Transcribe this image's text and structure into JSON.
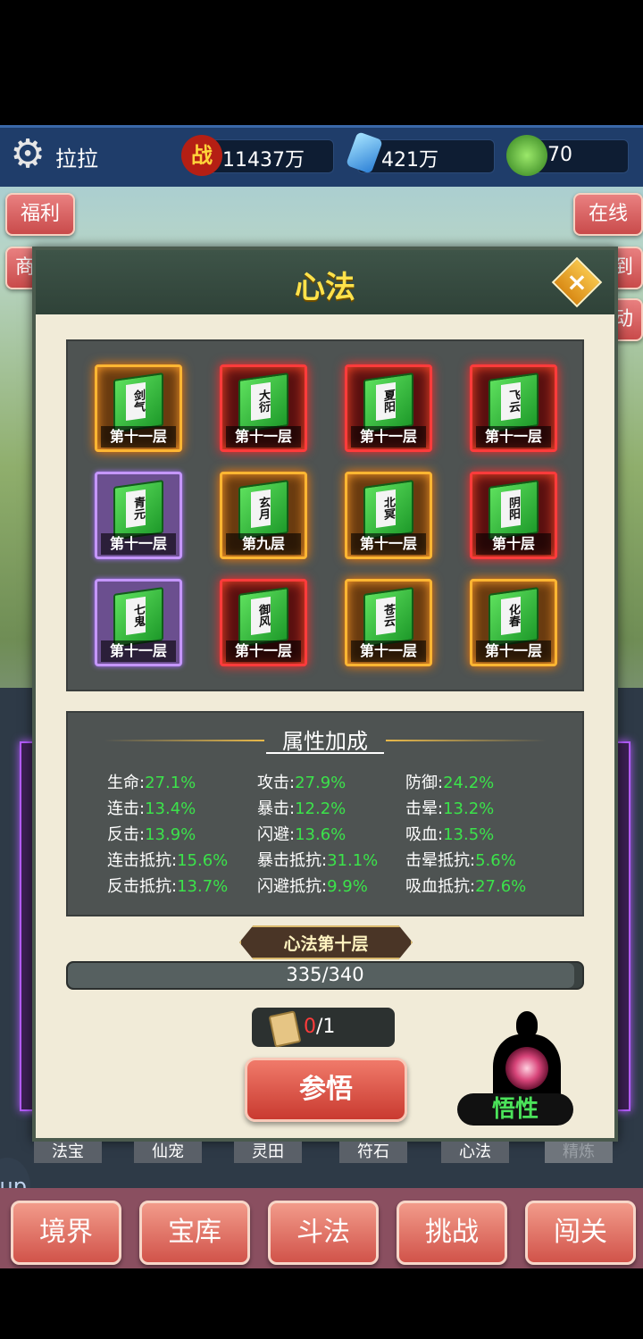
{
  "topbar": {
    "username": "拉拉",
    "power_icon_text": "战",
    "power": "11437万",
    "crystal": "421万",
    "jade": "70"
  },
  "side_buttons": {
    "welfare": "福利",
    "shop_partial": "商",
    "online": "在线",
    "checkin_partial": "到",
    "activity_partial": "动"
  },
  "dialog": {
    "title": "心法",
    "close": "×",
    "books": [
      {
        "name": "剑气",
        "layer": "第十一层",
        "frame": "gold"
      },
      {
        "name": "大衍",
        "layer": "第十一层",
        "frame": "red"
      },
      {
        "name": "夏阳",
        "layer": "第十一层",
        "frame": "red"
      },
      {
        "name": "飞云",
        "layer": "第十一层",
        "frame": "red"
      },
      {
        "name": "青元",
        "layer": "第十一层",
        "frame": "purple"
      },
      {
        "name": "玄月",
        "layer": "第九层",
        "frame": "gold"
      },
      {
        "name": "北冥",
        "layer": "第十一层",
        "frame": "gold"
      },
      {
        "name": "阴阳",
        "layer": "第十层",
        "frame": "red"
      },
      {
        "name": "七鬼",
        "layer": "第十一层",
        "frame": "purple"
      },
      {
        "name": "御风",
        "layer": "第十一层",
        "frame": "red"
      },
      {
        "name": "苍云",
        "layer": "第十一层",
        "frame": "gold"
      },
      {
        "name": "化春",
        "layer": "第十一层",
        "frame": "gold"
      }
    ],
    "attr_title": "属性加成",
    "attributes": [
      {
        "label": "生命:",
        "value": "27.1%"
      },
      {
        "label": "攻击:",
        "value": "27.9%"
      },
      {
        "label": "防御:",
        "value": "24.2%"
      },
      {
        "label": "连击:",
        "value": "13.4%"
      },
      {
        "label": "暴击:",
        "value": "12.2%"
      },
      {
        "label": "击晕:",
        "value": "13.2%"
      },
      {
        "label": "反击:",
        "value": "13.9%"
      },
      {
        "label": "闪避:",
        "value": "13.6%"
      },
      {
        "label": "吸血:",
        "value": "13.5%"
      },
      {
        "label": "连击抵抗:",
        "value": "15.6%"
      },
      {
        "label": "暴击抵抗:",
        "value": "31.1%"
      },
      {
        "label": "击晕抵抗:",
        "value": "5.6%"
      },
      {
        "label": "反击抵抗:",
        "value": "13.7%"
      },
      {
        "label": "闪避抵抗:",
        "value": "9.9%"
      },
      {
        "label": "吸血抵抗:",
        "value": "27.6%"
      }
    ],
    "level_badge": "心法第十层",
    "progress_text": "335/340",
    "progress_fraction": 0.985,
    "cost_have": "0",
    "cost_need": "/1",
    "comprehend_button": "参悟",
    "wuxing_label": "悟性"
  },
  "tabs": [
    "法宝",
    "仙宠",
    "灵田",
    "符石",
    "心法",
    "精炼"
  ],
  "bottom_nav": [
    "境界",
    "宝库",
    "斗法",
    "挑战",
    "闯关"
  ],
  "floating_button": "up"
}
